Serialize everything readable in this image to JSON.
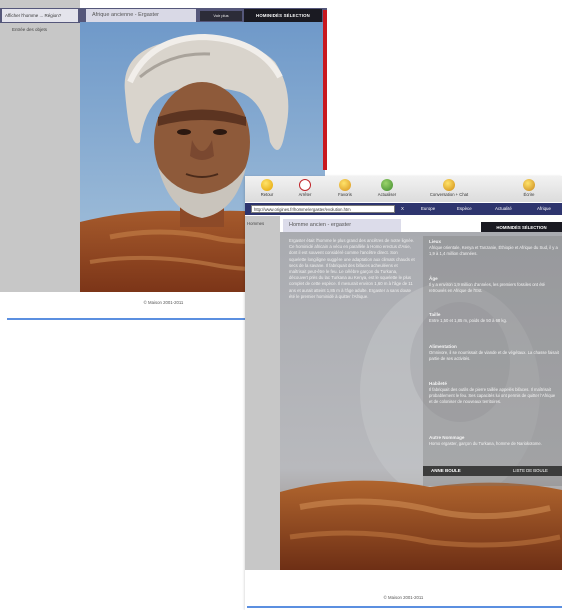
{
  "window_back": {
    "tab_active": "Afficher l'homme ... Région?",
    "tab_title": "Afrique ancienne - Ergaster",
    "tab_dark": "Voir plus",
    "tab_black": "HOMINIDÉS SÉLECTION",
    "side_label": "Entrée des objets",
    "footer": "© Maison 2001-2011"
  },
  "window_front": {
    "toolbar": [
      {
        "label": "Retour",
        "icon": "back-arrow-icon"
      },
      {
        "label": "Arrêter",
        "icon": "stop-icon"
      },
      {
        "label": "Favoris",
        "icon": "favorites-icon"
      },
      {
        "label": "Actualiser",
        "icon": "refresh-icon"
      },
      {
        "label": "Conversation + Chat",
        "icon": "chat-icon"
      },
      {
        "label": "Écrire",
        "icon": "write-icon"
      }
    ],
    "url": "http://www.origines.fr/homme/ergaster/evolution.htm",
    "nav_links": [
      "X",
      "Europe",
      "Espèce",
      "Actualité",
      "Afrique"
    ],
    "side_label": "Hommes",
    "tab_title": "Homme ancien - ergaster",
    "tab_black": "HOMINIDÉS SÉLECTION",
    "article": "Ergaster était l'homme le plus grand des ancêtres de notre lignée. Ce hominidé africain a vécu en parallèle à Homo erectus d'Asie, dont il est souvent considéré comme l'ancêtre direct. Son squelette longiligne suggère une adaptation aux climats chauds et secs de la savane. Il fabriquait des bifaces acheuléens et maîtrisait peut-être le feu. Le célèbre garçon du Turkana, découvert près du lac Turkana au Kenya, est le squelette le plus complet de cette espèce. Il mesurait environ 1,60 m à l'âge de 11 ans et aurait atteint 1,85 m à l'âge adulte. Ergaster a sans doute été le premier hominidé à quitter l'Afrique.",
    "facts": [
      {
        "title": "Lieux",
        "text": "Afrique orientale, Kenya et Tanzanie, Éthiopie et Afrique du Sud, il y a 1,9 à 1,4 million d'années."
      },
      {
        "title": "Âge",
        "text": "Il y a environ 1,9 million d'années, les premiers fossiles ont été retrouvés en Afrique de l'Est."
      },
      {
        "title": "Taille",
        "text": "Entre 1,50 et 1,85 m, poids de 50 à 68 kg."
      },
      {
        "title": "Alimentation",
        "text": "Omnivore, il se nourrissait de viande et de végétaux. La chasse faisait partie de ses activités."
      },
      {
        "title": "Habileté",
        "text": "Il fabriquait des outils de pierre taillée appelés bifaces. Il maîtrisait probablement le feu. Ses capacités lui ont permis de quitter l'Afrique et de coloniser de nouveaux territoires."
      },
      {
        "title": "Autre Nommage",
        "text": "Homo ergaster, garçon du Turkana, homme de Nariokotome."
      }
    ],
    "boule_name": "ANNE BOULE",
    "boule_link": "LISTE DE BOULE",
    "footer": "© Maison 2001-2011"
  }
}
